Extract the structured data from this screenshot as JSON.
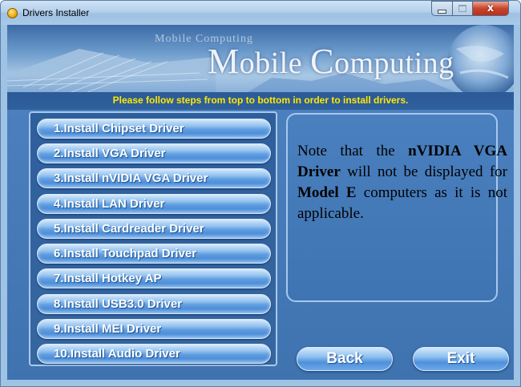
{
  "window": {
    "title": "Drivers Installer",
    "icon": "disc-icon",
    "controls": [
      "minimize",
      "maximize",
      "close"
    ],
    "close_glyph": "x"
  },
  "banner": {
    "small_text": "Mobile Computing",
    "big_text_first_cap": "M",
    "big_text_first_rest": "obile ",
    "big_text_second_cap": "C",
    "big_text_second_rest": "omputing"
  },
  "instruction": "Please follow steps from top to bottom in order to install drivers.",
  "driver_buttons": [
    "1.Install Chipset Driver",
    "2.Install VGA Driver",
    "3.Install nVIDIA VGA Driver",
    "4.Install LAN Driver",
    "5.Install Cardreader Driver",
    "6.Install Touchpad Driver",
    "7.Install Hotkey AP",
    "8.Install USB3.0 Driver",
    "9.Install MEI Driver",
    "10.Install Audio Driver"
  ],
  "note": {
    "part1": "Note that the ",
    "bold1": "nVIDIA VGA Driver",
    "part2": " will not be displayed for ",
    "bold2": "Model E",
    "part3": " computers as it is not applicable."
  },
  "actions": {
    "back": "Back",
    "exit": "Exit"
  },
  "colors": {
    "instruction_text": "#ffe800",
    "background": "#4478b5",
    "button_text": "#ffffff"
  }
}
